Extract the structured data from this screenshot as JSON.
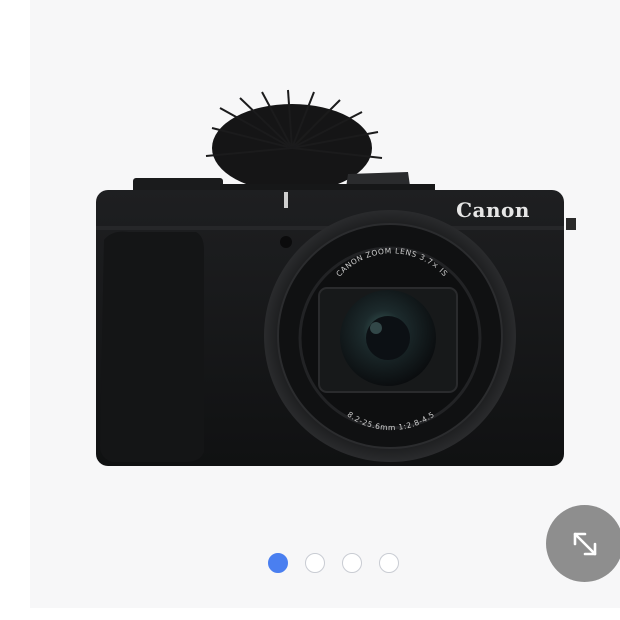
{
  "gallery": {
    "image": {
      "brand": "Canon",
      "lens_top_text": "CANON ZOOM LENS 3.7× IS",
      "lens_bottom_text": "8.2-25.6mm 1:2.8-4.5"
    },
    "slides": [
      {
        "active": true
      },
      {
        "active": false
      },
      {
        "active": false
      },
      {
        "active": false
      }
    ],
    "expand_button": {
      "icon": "expand-icon"
    }
  },
  "colors": {
    "gallery_background": "#f7f7f8",
    "dot_active": "#4a7ff0",
    "expand_button": "#8e8e8e"
  }
}
